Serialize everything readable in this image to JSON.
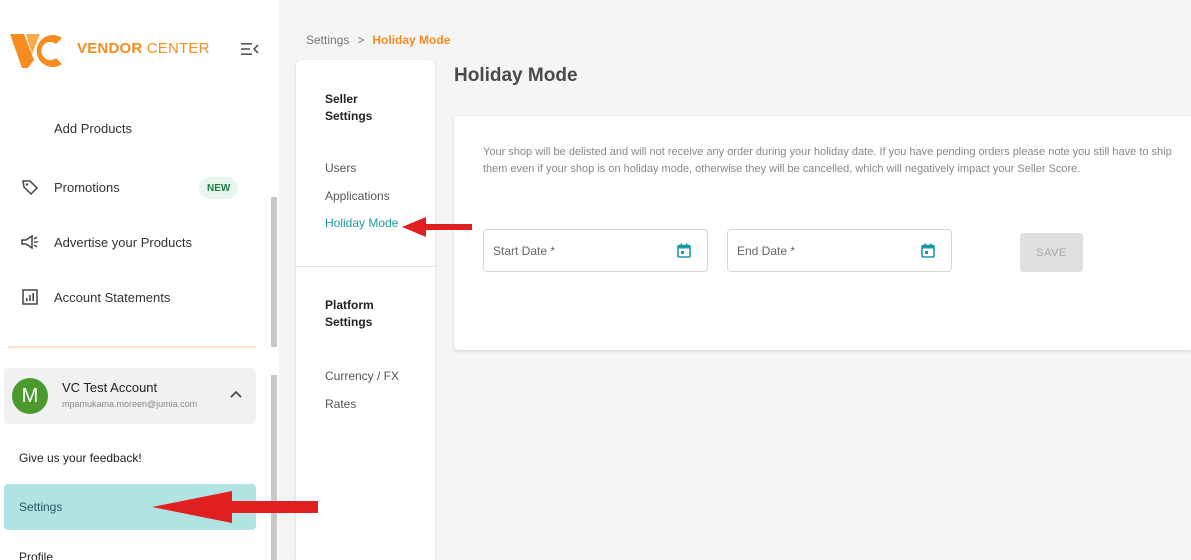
{
  "brand": {
    "name_bold": "VENDOR",
    "name_rest": " CENTER"
  },
  "sidebar": {
    "items": [
      {
        "label": "Add Products"
      },
      {
        "label": "Promotions",
        "badge": "NEW"
      },
      {
        "label": "Advertise your Products"
      },
      {
        "label": "Account Statements"
      }
    ],
    "account": {
      "initial": "M",
      "name": "VC Test Account",
      "email": "mpamukama.moreen@jumia.com"
    },
    "feedback": "Give us your feedback!",
    "settings": "Settings",
    "profile": "Profile"
  },
  "breadcrumb": {
    "parent": "Settings",
    "separator": ">",
    "current": "Holiday Mode"
  },
  "settings_nav": {
    "seller_heading": "Seller Settings",
    "seller_links": [
      "Users",
      "Applications",
      "Holiday Mode"
    ],
    "platform_heading": "Platform Settings",
    "platform_links": [
      "Currency / FX Rates"
    ]
  },
  "page": {
    "title": "Holiday Mode",
    "notice": "Your shop will be delisted and will not receive any order during your holiday date. If you have pending orders please note you still have to ship them even if your shop is on holiday mode, otherwise they will be cancelled, which will negatively impact your Seller Score.",
    "start_date_placeholder": "Start Date *",
    "end_date_placeholder": "End Date *",
    "save_label": "SAVE"
  },
  "colors": {
    "brand_orange": "#f68b1e",
    "active_teal": "#1a9aa0",
    "settings_highlight": "#b2e3e3",
    "annotation_arrow": "#e02020"
  }
}
